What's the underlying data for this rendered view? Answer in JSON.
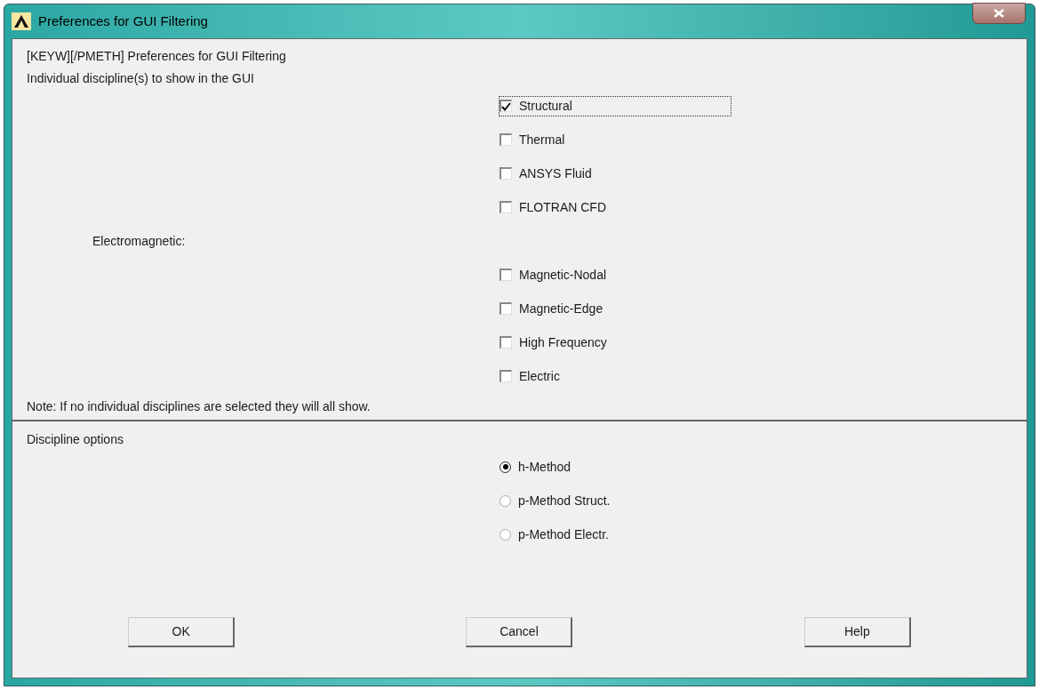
{
  "window": {
    "title": "Preferences for GUI Filtering"
  },
  "heading": "[KEYW][/PMETH] Preferences for GUI Filtering",
  "disciplines": {
    "label": "Individual discipline(s) to show in the GUI",
    "items": [
      {
        "kind": "checkbox",
        "label": "Structural",
        "checked": true,
        "focused": true
      },
      {
        "kind": "checkbox",
        "label": "Thermal",
        "checked": false,
        "focused": false
      },
      {
        "kind": "checkbox",
        "label": "ANSYS Fluid",
        "checked": false,
        "focused": false
      },
      {
        "kind": "checkbox",
        "label": "FLOTRAN CFD",
        "checked": false,
        "focused": false
      },
      {
        "kind": "group",
        "label": "Electromagnetic:"
      },
      {
        "kind": "checkbox",
        "label": "Magnetic-Nodal",
        "checked": false,
        "focused": false
      },
      {
        "kind": "checkbox",
        "label": "Magnetic-Edge",
        "checked": false,
        "focused": false
      },
      {
        "kind": "checkbox",
        "label": "High Frequency",
        "checked": false,
        "focused": false
      },
      {
        "kind": "checkbox",
        "label": "Electric",
        "checked": false,
        "focused": false
      }
    ],
    "note": "Note: If no individual disciplines are selected they will all show."
  },
  "options": {
    "label": "Discipline options",
    "items": [
      {
        "label": "h-Method",
        "selected": true
      },
      {
        "label": "p-Method Struct.",
        "selected": false
      },
      {
        "label": "p-Method Electr.",
        "selected": false
      }
    ]
  },
  "buttons": [
    "OK",
    "Cancel",
    "Help"
  ]
}
